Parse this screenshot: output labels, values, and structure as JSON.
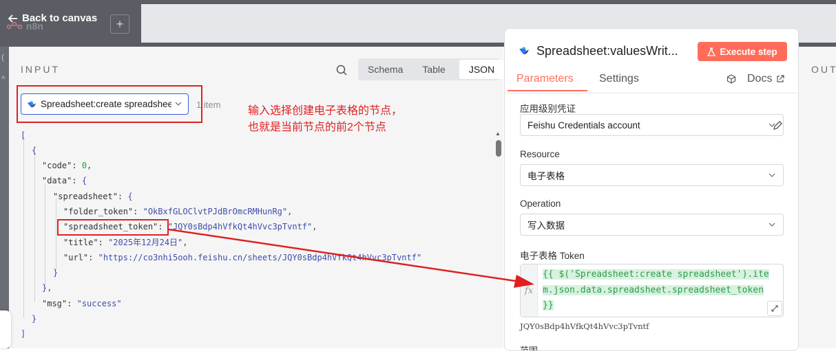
{
  "topbar": {
    "back_label": "Back to canvas",
    "logo_text": "n8n",
    "add_label": "+"
  },
  "input": {
    "title": "INPUT",
    "tabs": [
      "Schema",
      "Table",
      "JSON"
    ],
    "active_tab": "JSON",
    "node_select_value": "Spreadsheet:create spreadsheet",
    "item_count": "1 item",
    "annotation_line1": "输入选择创建电子表格的节点，",
    "annotation_line2": "也就是当前节点的前2个节点",
    "json": {
      "open_bracket": "[",
      "open_obj": "{",
      "code_key": "\"code\":",
      "code_val": "0",
      "data_key": "\"data\":",
      "data_open": "{",
      "spreadsheet_key": "\"spreadsheet\":",
      "spreadsheet_open": "{",
      "folder_token_key": "\"folder_token\":",
      "folder_token_val": "\"OkBxfGLOClvtPJdBrOmcRMHunRg\"",
      "spreadsheet_token_key": "\"spreadsheet_token\":",
      "spreadsheet_token_val": "\"JQY0sBdp4hVfkQt4hVvc3pTvntf\"",
      "title_key": "\"title\":",
      "title_val": "\"2025年12月24日\"",
      "url_key": "\"url\":",
      "url_val": "\"https://co3nhi5ooh.feishu.cn/sheets/JQY0sBdp4hVfkQt4hVvc3pTvntf\"",
      "close_inner": "}",
      "close_data": "},",
      "msg_key": "\"msg\":",
      "msg_val": "\"success\"",
      "close_obj": "}",
      "close_bracket": "]"
    }
  },
  "panel": {
    "title": "Spreadsheet:valuesWrit...",
    "execute_label": "Execute step",
    "tabs": {
      "parameters": "Parameters",
      "settings": "Settings",
      "docs": "Docs"
    },
    "credential_label": "应用级别凭证",
    "credential_value": "Feishu Credentials account",
    "resource_label": "Resource",
    "resource_value": "电子表格",
    "operation_label": "Operation",
    "operation_value": "写入数据",
    "token_label": "电子表格 Token",
    "token_expression_line1": "{{ $('Spreadsheet:create spreadsheet').ite",
    "token_expression_line2": "m.json.data.spreadsheet.spreadsheet_token ",
    "token_expression_line3": "}}",
    "fx_label": "fx",
    "token_preview": "JQY0sBdp4hVfkQt4hVvc3pTvntf",
    "next_label_partial": "范围"
  },
  "output": {
    "title": "OUT"
  },
  "colors": {
    "accent": "#ff6d5a",
    "annotation_red": "#e02020",
    "select_border": "#3b5bdb",
    "topbar": "#5a5d63"
  }
}
